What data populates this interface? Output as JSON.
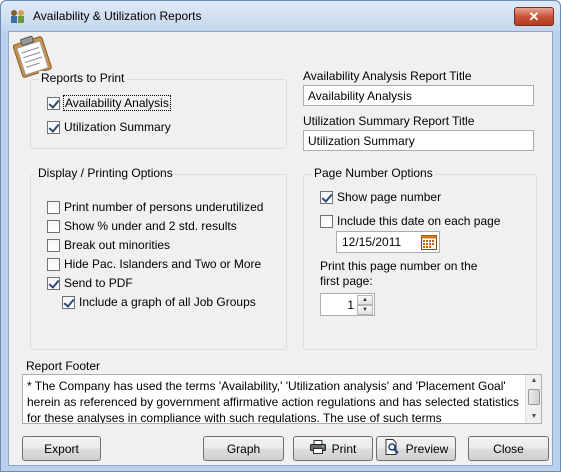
{
  "window": {
    "title": "Availability & Utilization Reports",
    "close_glyph": "✕"
  },
  "reports_to_print": {
    "label": "Reports to Print",
    "items": [
      {
        "label": "Availability Analysis",
        "checked": true
      },
      {
        "label": "Utilization Summary",
        "checked": true
      }
    ]
  },
  "titles": {
    "availability_label": "Availability Analysis Report Title",
    "availability_value": "Availability Analysis",
    "utilization_label": "Utilization Summary Report Title",
    "utilization_value": "Utilization Summary"
  },
  "display_options": {
    "label": "Display / Printing Options",
    "items": [
      {
        "label": "Print number of persons underutilized",
        "checked": false
      },
      {
        "label": "Show % under and 2 std. results",
        "checked": false
      },
      {
        "label": "Break out minorities",
        "checked": false
      },
      {
        "label": "Hide Pac. Islanders and Two or More",
        "checked": false
      },
      {
        "label": "Send to PDF",
        "checked": true
      },
      {
        "label": "Include a graph of all Job Groups",
        "checked": true
      }
    ]
  },
  "page_number_options": {
    "label": "Page Number Options",
    "show_page_number": {
      "label": "Show page number",
      "checked": true
    },
    "include_date": {
      "label": "Include this date on each page",
      "checked": false
    },
    "date_value": "12/15/2011",
    "first_page_label": "Print this page number on the first page:",
    "first_page_value": "1"
  },
  "report_footer": {
    "label": "Report Footer",
    "text": "* The Company has used the terms 'Availability,' 'Utilization analysis' and 'Placement Goal' herein as referenced by government affirmative action regulations and has selected statistics for these analyses in compliance with such regulations. The use of such terms"
  },
  "buttons": {
    "export": "Export",
    "graph": "Graph",
    "print": "Print",
    "preview": "Preview",
    "close": "Close"
  },
  "icons": [
    "app-icon",
    "clipboard-icon",
    "calendar-icon",
    "printer-icon",
    "preview-icon"
  ]
}
